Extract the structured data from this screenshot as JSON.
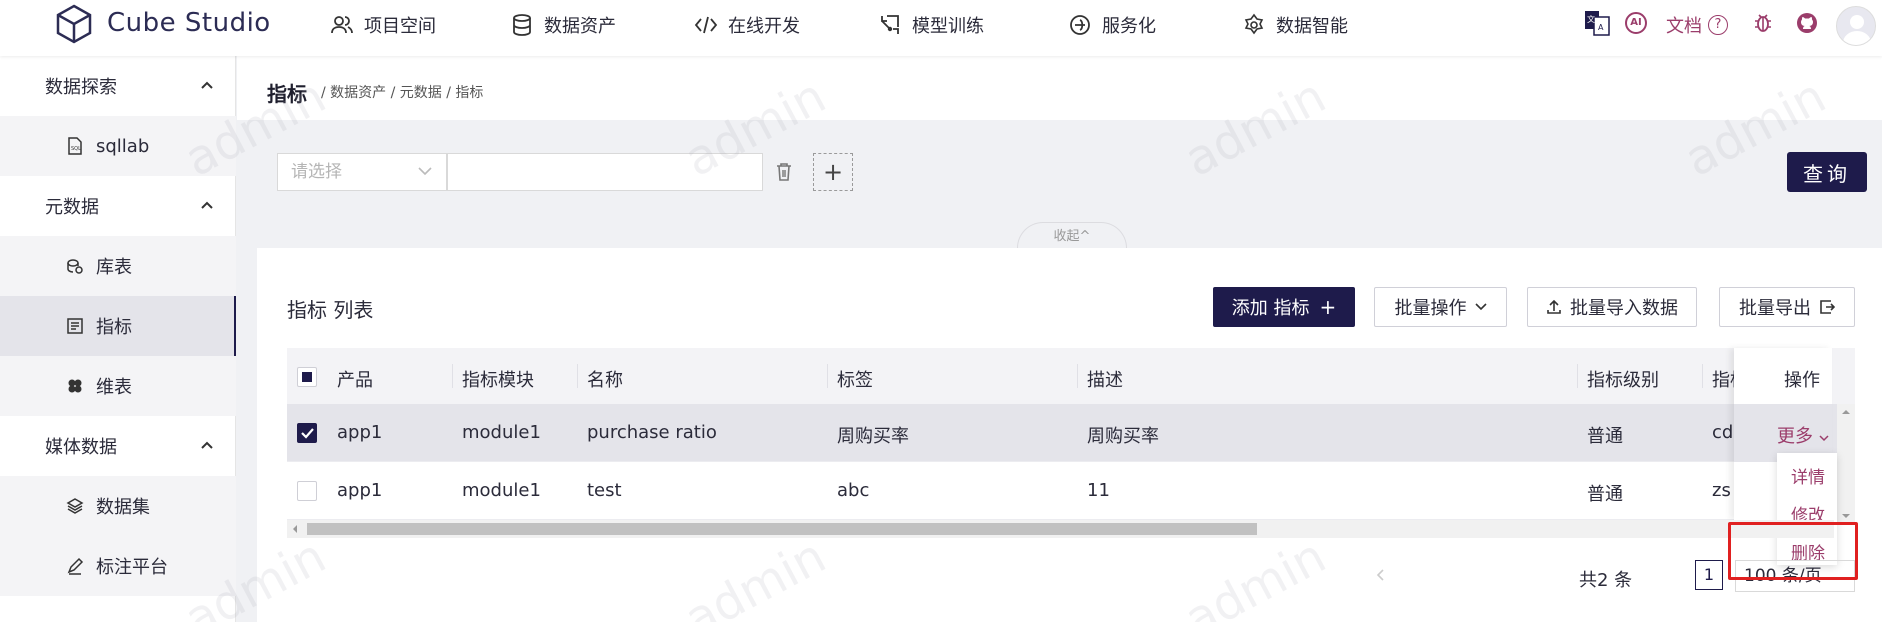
{
  "app": {
    "brand": "Cube Studio"
  },
  "nav": [
    {
      "label": "项目空间",
      "icon": "users-icon"
    },
    {
      "label": "数据资产",
      "icon": "database-icon"
    },
    {
      "label": "在线开发",
      "icon": "code-icon"
    },
    {
      "label": "模型训练",
      "icon": "model-icon"
    },
    {
      "label": "服务化",
      "icon": "service-icon"
    },
    {
      "label": "数据智能",
      "icon": "ai-icon"
    }
  ],
  "topright": {
    "docs": "文档",
    "ai_badge": "AI",
    "translate_glyph": "文A"
  },
  "sidebar": {
    "groups": [
      {
        "label": "数据探索",
        "items": [
          {
            "label": "sqllab",
            "icon": "sql-file-icon"
          }
        ]
      },
      {
        "label": "元数据",
        "items": [
          {
            "label": "库表",
            "icon": "table-icon"
          },
          {
            "label": "指标",
            "icon": "metric-icon"
          },
          {
            "label": "维表",
            "icon": "dimension-icon"
          }
        ]
      },
      {
        "label": "媒体数据",
        "items": [
          {
            "label": "数据集",
            "icon": "layers-icon"
          },
          {
            "label": "标注平台",
            "icon": "pen-icon"
          }
        ]
      }
    ]
  },
  "page": {
    "title": "指标",
    "breadcrumb": "/ 数据资产 / 元数据 / 指标"
  },
  "filter": {
    "select_placeholder": "请选择",
    "query_label": "查询",
    "collapse_label": "收起^",
    "add_symbol": "+"
  },
  "list": {
    "title": "指标 列表",
    "buttons": {
      "add": "添加 指标",
      "add_symbol": "+",
      "batch_ops": "批量操作",
      "batch_import": "批量导入数据",
      "batch_export": "批量导出"
    },
    "columns": [
      "产品",
      "指标模块",
      "名称",
      "标签",
      "描述",
      "指标级别",
      "指标",
      "操作"
    ],
    "rows": [
      {
        "product": "app1",
        "module": "module1",
        "name": "purchase ratio",
        "tag": "周购买率",
        "desc": "周购买率",
        "level": "普通",
        "owner": "cdl",
        "checked": true
      },
      {
        "product": "app1",
        "module": "module1",
        "name": "test",
        "tag": "abc",
        "desc": "11",
        "level": "普通",
        "owner": "zs",
        "checked": false
      }
    ],
    "more_label": "更多",
    "dropdown": [
      "详情",
      "修改",
      "删除"
    ]
  },
  "pagination": {
    "total": "共2 条",
    "current": "1",
    "page_size": "100 条/页"
  },
  "watermark": "admin",
  "colors": {
    "primary": "#1e1b4b",
    "link": "#9b3d6b",
    "highlight_box": "#e02020"
  }
}
